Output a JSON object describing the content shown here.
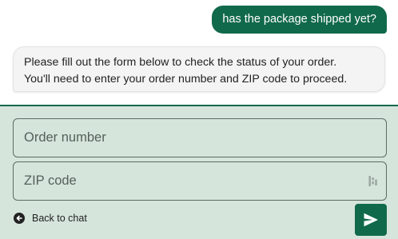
{
  "chat": {
    "user_message": "has the package shipped yet?",
    "bot_message_line1": "Please fill out the form below to check the status of your order.",
    "bot_message_line2": "You'll need to enter your order number and ZIP code to proceed."
  },
  "form": {
    "order_placeholder": "Order number",
    "order_value": "",
    "zip_placeholder": "ZIP code",
    "zip_value": "",
    "back_label": "Back to chat",
    "zip_field_icon": "password-manager-icon",
    "back_icon": "arrow-left-circle-icon",
    "send_icon": "send-icon"
  },
  "colors": {
    "accent": "#11694b",
    "form_background": "#d6e5dc",
    "bot_bubble": "#f4f4f4"
  }
}
